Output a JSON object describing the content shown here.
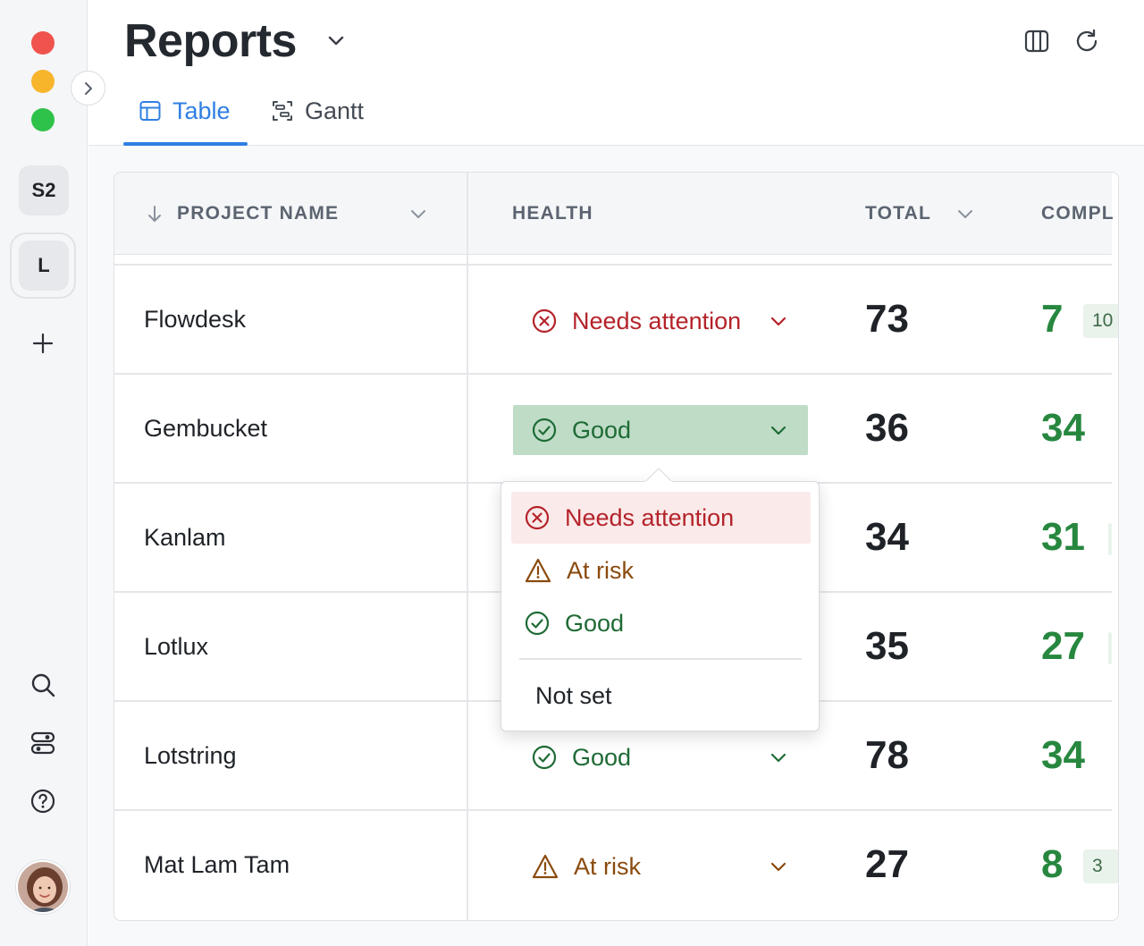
{
  "window": {
    "controls": [
      "close",
      "minimize",
      "zoom"
    ]
  },
  "rail": {
    "workspaces": [
      "S2",
      "L"
    ],
    "add_icon": "plus-icon",
    "bottom_icons": [
      "search-icon",
      "toggles-icon",
      "help-icon"
    ],
    "avatar": "user-avatar"
  },
  "header": {
    "title": "Reports",
    "tabs": [
      {
        "label": "Table",
        "icon": "table-icon",
        "active": true
      },
      {
        "label": "Gantt",
        "icon": "gantt-icon",
        "active": false
      }
    ],
    "actions": [
      "columns-icon",
      "refresh-icon"
    ]
  },
  "table": {
    "columns": {
      "project": "PROJECT NAME",
      "health": "HEALTH",
      "total": "TOTAL",
      "completed": "COMPL"
    },
    "rows": [
      {
        "name": "Flowdesk",
        "health": "Needs attention",
        "total": "73",
        "completed": "7",
        "chip": "10"
      },
      {
        "name": "Gembucket",
        "health": "Good",
        "total": "36",
        "completed": "34"
      },
      {
        "name": "Kanlam",
        "health": "",
        "total": "34",
        "completed": "31"
      },
      {
        "name": "Lotlux",
        "health": "",
        "total": "35",
        "completed": "27"
      },
      {
        "name": "Lotstring",
        "health": "Good",
        "total": "78",
        "completed": "34"
      },
      {
        "name": "Mat Lam Tam",
        "health": "At risk",
        "total": "27",
        "completed": "8",
        "chip": "3"
      }
    ]
  },
  "dropdown": {
    "options": [
      "Needs attention",
      "At risk",
      "Good"
    ],
    "none_option": "Not set"
  },
  "colors": {
    "accent": "#2f7fe3",
    "needs_attention": "#b4232a",
    "at_risk": "#8a4a0d",
    "good": "#1e6b35",
    "good_selected_bg": "#bfdcc7",
    "completed_green": "#27873f"
  }
}
